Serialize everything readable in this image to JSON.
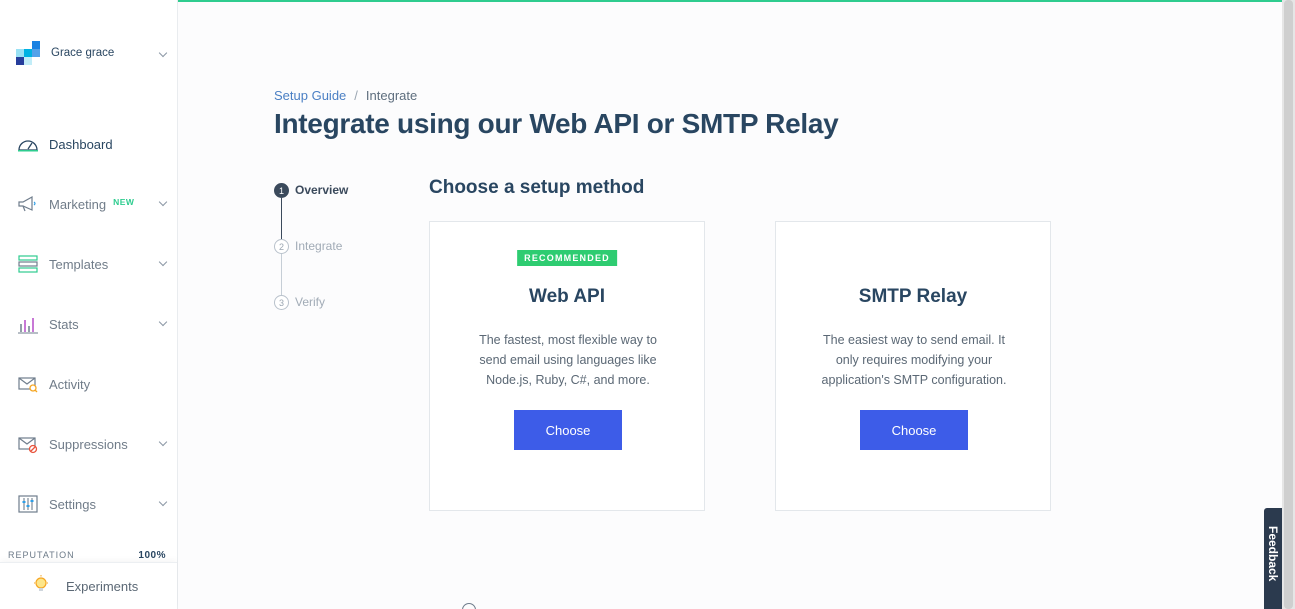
{
  "account": {
    "name": "Grace grace"
  },
  "nav": {
    "dashboard": "Dashboard",
    "marketing": "Marketing",
    "marketing_badge": "NEW",
    "templates": "Templates",
    "stats": "Stats",
    "activity": "Activity",
    "suppressions": "Suppressions",
    "settings": "Settings",
    "experiments": "Experiments"
  },
  "reputation": {
    "label": "REPUTATION",
    "value": "100%"
  },
  "breadcrumb": {
    "parent": "Setup Guide",
    "separator": "/",
    "current": "Integrate"
  },
  "page_title": "Integrate using our Web API or SMTP Relay",
  "steps": [
    {
      "number": "1",
      "label": "Overview"
    },
    {
      "number": "2",
      "label": "Integrate"
    },
    {
      "number": "3",
      "label": "Verify"
    }
  ],
  "section_title": "Choose a setup method",
  "cards": {
    "web_api": {
      "badge": "RECOMMENDED",
      "title": "Web API",
      "description": "The fastest, most flexible way to send email using languages like Node.js, Ruby, C#, and more.",
      "button": "Choose"
    },
    "smtp": {
      "title": "SMTP Relay",
      "description": "The easiest way to send email. It only requires modifying your application's SMTP configuration.",
      "button": "Choose"
    }
  },
  "feedback": "Feedback",
  "colors": {
    "accent": "#3d5ce8",
    "success": "#2ecc71",
    "navy": "#294661"
  }
}
